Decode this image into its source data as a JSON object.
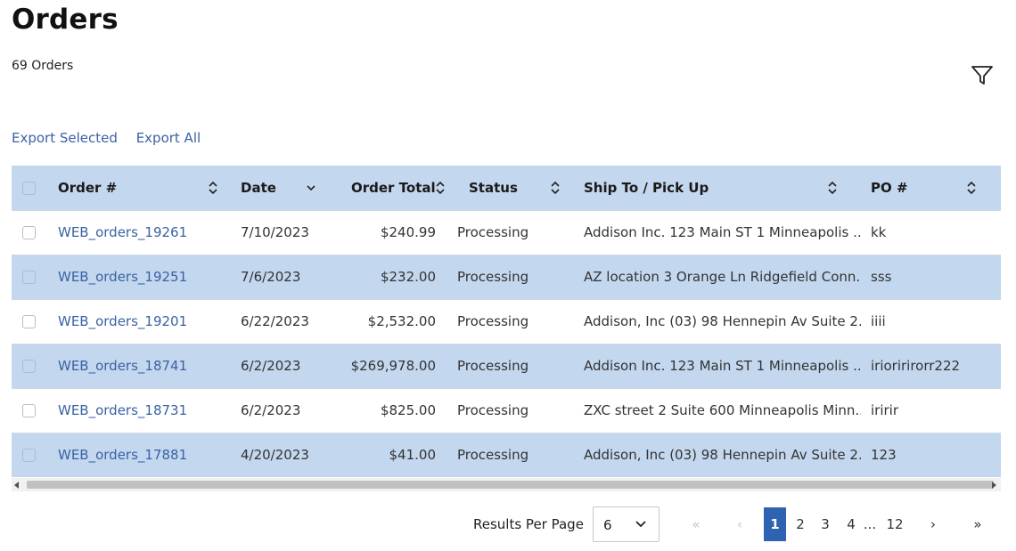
{
  "page": {
    "title": "Orders",
    "count_label": "69 Orders"
  },
  "actions": {
    "export_selected": "Export Selected",
    "export_all": "Export All",
    "filter_icon": "filter-icon"
  },
  "table": {
    "columns": [
      "Order #",
      "Date",
      "Order Total",
      "Status",
      "Ship To / Pick Up",
      "PO #"
    ],
    "rows": [
      {
        "order": "WEB_orders_19261",
        "date": "7/10/2023",
        "total": "$240.99",
        "status": "Processing",
        "ship_to": "Addison Inc. 123 Main ST 1 Minneapolis ...",
        "po": "kk"
      },
      {
        "order": "WEB_orders_19251",
        "date": "7/6/2023",
        "total": "$232.00",
        "status": "Processing",
        "ship_to": "AZ location 3 Orange Ln Ridgefield Conn...",
        "po": "sss"
      },
      {
        "order": "WEB_orders_19201",
        "date": "6/22/2023",
        "total": "$2,532.00",
        "status": "Processing",
        "ship_to": "Addison, Inc (03) 98 Hennepin Av Suite 2...",
        "po": "iiii"
      },
      {
        "order": "WEB_orders_18741",
        "date": "6/2/2023",
        "total": "$269,978.00",
        "status": "Processing",
        "ship_to": "Addison Inc. 123 Main ST 1 Minneapolis ...",
        "po": "irioririrorr222"
      },
      {
        "order": "WEB_orders_18731",
        "date": "6/2/2023",
        "total": "$825.00",
        "status": "Processing",
        "ship_to": "ZXC street 2 Suite 600 Minneapolis Minn...",
        "po": "iririr"
      },
      {
        "order": "WEB_orders_17881",
        "date": "4/20/2023",
        "total": "$41.00",
        "status": "Processing",
        "ship_to": "Addison, Inc (03) 98 Hennepin Av Suite 2...",
        "po": "123"
      }
    ]
  },
  "pagination": {
    "results_per_page_label": "Results Per Page",
    "results_per_page_value": "6",
    "first": "«",
    "prev": "‹",
    "pages": [
      "1",
      "2",
      "3",
      "4"
    ],
    "ellipsis": "...",
    "last_page": "12",
    "next": "›",
    "last": "»",
    "current": "1"
  },
  "colors": {
    "header_bg": "#c3d7ef",
    "link": "#3b62a3",
    "active_page": "#2d63b0"
  }
}
